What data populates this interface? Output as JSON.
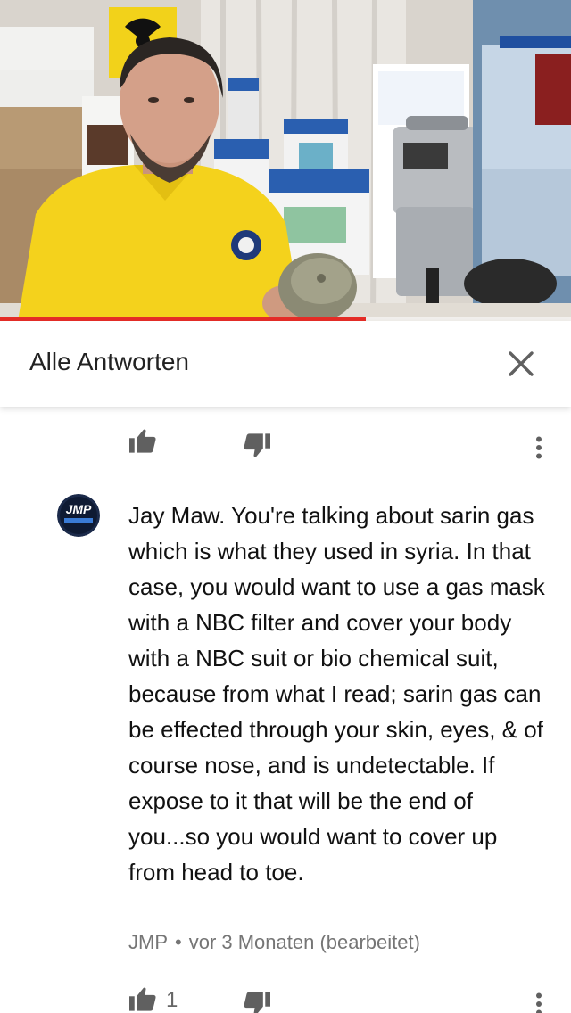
{
  "video": {
    "progress_percent": 64
  },
  "header": {
    "title": "Alle Antworten",
    "close_icon": "close-icon"
  },
  "previous_comment_actions": {
    "like_icon": "thumb-up-icon",
    "dislike_icon": "thumb-down-icon",
    "more_icon": "more-vertical-icon"
  },
  "comment": {
    "avatar_text": "JMP",
    "text": "Jay Maw. You're talking about sarin gas which is what they used in syria. In that case, you would want to use a gas mask with a NBC filter and cover your body with a NBC suit or bio chemical suit, because from what I read; sarin gas can be effected through your skin, eyes, & of course nose, and is undetectable. If expose to it that will be the end of you...so you would want to cover up from head to toe.",
    "author": "JMP",
    "separator": "•",
    "time": "vor 3 Monaten (bearbeitet)",
    "like_count": "1"
  },
  "colors": {
    "progress": "#e52d27",
    "icon": "#606060",
    "meta_text": "#757575"
  }
}
